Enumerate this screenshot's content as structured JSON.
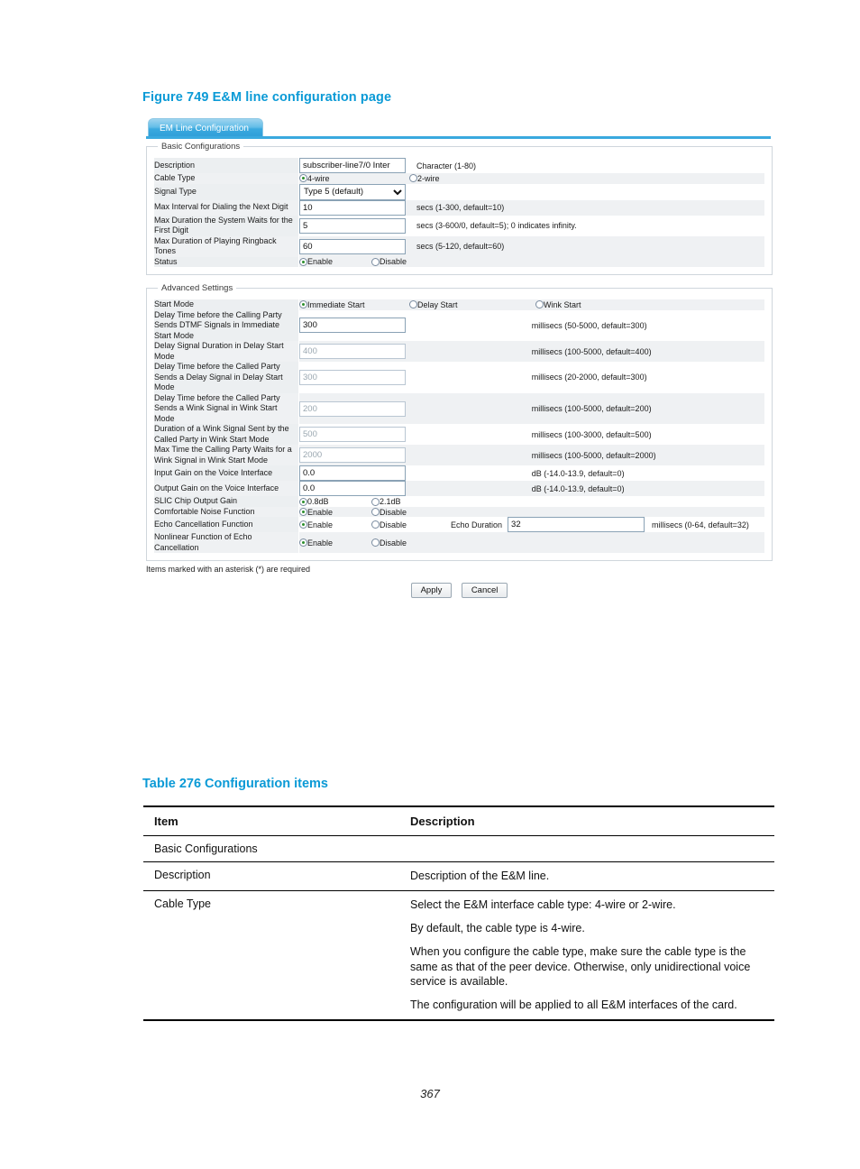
{
  "figure": {
    "caption": "Figure 749 E&M line configuration page"
  },
  "screenshot": {
    "tab_label": "EM Line Configuration",
    "basic": {
      "title": "Basic Configurations",
      "rows": [
        {
          "label": "Description",
          "type": "text",
          "value": "subscriber-line7/0 Inter",
          "hint": "Character (1-80)"
        },
        {
          "label": "Cable Type",
          "type": "radio",
          "options": [
            {
              "label": "4-wire",
              "selected": true
            },
            {
              "label": "2-wire",
              "selected": false
            }
          ],
          "hint": ""
        },
        {
          "label": "Signal Type",
          "type": "select",
          "value": "Type 5 (default)",
          "options": [
            "Type 5 (default)"
          ],
          "hint": ""
        },
        {
          "label": "Max Interval for Dialing the Next Digit",
          "type": "text",
          "value": "10",
          "hint": "secs (1-300, default=10)"
        },
        {
          "label": "Max Duration the System Waits for the First Digit",
          "type": "text",
          "value": "5",
          "hint": "secs (3-600/0, default=5); 0 indicates infinity."
        },
        {
          "label": "Max Duration of Playing Ringback Tones",
          "type": "text",
          "value": "60",
          "hint": "secs (5-120, default=60)"
        },
        {
          "label": "Status",
          "type": "radio",
          "options": [
            {
              "label": "Enable",
              "selected": true
            },
            {
              "label": "Disable",
              "selected": false
            }
          ],
          "hint": ""
        }
      ]
    },
    "advanced": {
      "title": "Advanced Settings",
      "start_mode": {
        "label": "Start Mode",
        "options": [
          {
            "label": "Immediate Start",
            "selected": true
          },
          {
            "label": "Delay Start",
            "selected": false
          },
          {
            "label": "Wink Start",
            "selected": false
          }
        ]
      },
      "rows": [
        {
          "label": "Delay Time before the Calling Party Sends DTMF Signals in Immediate Start Mode",
          "type": "text",
          "value": "300",
          "disabled": false,
          "hint": "millisecs (50-5000, default=300)"
        },
        {
          "label": "Delay Signal Duration in Delay Start Mode",
          "type": "text",
          "value": "400",
          "disabled": true,
          "hint": "millisecs (100-5000, default=400)"
        },
        {
          "label": "Delay Time before the Called Party Sends a Delay Signal in Delay Start Mode",
          "type": "text",
          "value": "300",
          "disabled": true,
          "hint": "millisecs (20-2000, default=300)"
        },
        {
          "label": "Delay Time before the Called Party Sends a Wink Signal in Wink Start Mode",
          "type": "text",
          "value": "200",
          "disabled": true,
          "hint": "millisecs (100-5000, default=200)"
        },
        {
          "label": "Duration of a Wink Signal Sent by the Called Party in Wink Start Mode",
          "type": "text",
          "value": "500",
          "disabled": true,
          "hint": "millisecs (100-3000, default=500)"
        },
        {
          "label": "Max Time the Calling Party Waits for a Wink Signal in Wink Start Mode",
          "type": "text",
          "value": "2000",
          "disabled": true,
          "hint": "millisecs (100-5000, default=2000)"
        },
        {
          "label": "Input Gain on the Voice Interface",
          "type": "text",
          "value": "0.0",
          "disabled": false,
          "hint": "dB (-14.0-13.9, default=0)"
        },
        {
          "label": "Output Gain on the Voice Interface",
          "type": "text",
          "value": "0.0",
          "disabled": false,
          "hint": "dB (-14.0-13.9, default=0)"
        },
        {
          "label": "SLIC Chip Output Gain",
          "type": "radio",
          "options": [
            {
              "label": "0.8dB",
              "selected": true
            },
            {
              "label": "2.1dB",
              "selected": false
            }
          ],
          "hint": ""
        },
        {
          "label": "Comfortable Noise Function",
          "type": "radio",
          "options": [
            {
              "label": "Enable",
              "selected": true
            },
            {
              "label": "Disable",
              "selected": false
            }
          ],
          "hint": ""
        },
        {
          "label": "Echo Cancellation Function",
          "type": "radio-extra",
          "options": [
            {
              "label": "Enable",
              "selected": true
            },
            {
              "label": "Disable",
              "selected": false
            }
          ],
          "extra_label": "Echo Duration",
          "extra_value": "32",
          "hint": "millisecs (0-64, default=32)"
        },
        {
          "label": "Nonlinear Function of Echo Cancellation",
          "type": "radio",
          "options": [
            {
              "label": "Enable",
              "selected": true
            },
            {
              "label": "Disable",
              "selected": false
            }
          ],
          "hint": ""
        }
      ]
    },
    "footer_note": "Items marked with an asterisk (*) are required",
    "apply_label": "Apply",
    "cancel_label": "Cancel"
  },
  "table": {
    "caption": "Table 276 Configuration items",
    "headers": [
      "Item",
      "Description"
    ],
    "rows": [
      {
        "item": "Basic Configurations",
        "paragraphs": []
      },
      {
        "item": "Description",
        "paragraphs": [
          "Description of the E&M line."
        ]
      },
      {
        "item": "Cable Type",
        "paragraphs": [
          "Select the E&M interface cable type: 4-wire or 2-wire.",
          "By default, the cable type is 4-wire.",
          "When you configure the cable type, make sure the cable type is the same as that of the peer device. Otherwise, only unidirectional voice service is available.",
          "The configuration will be applied to all E&M interfaces of the card."
        ]
      }
    ]
  },
  "page_number": "367"
}
